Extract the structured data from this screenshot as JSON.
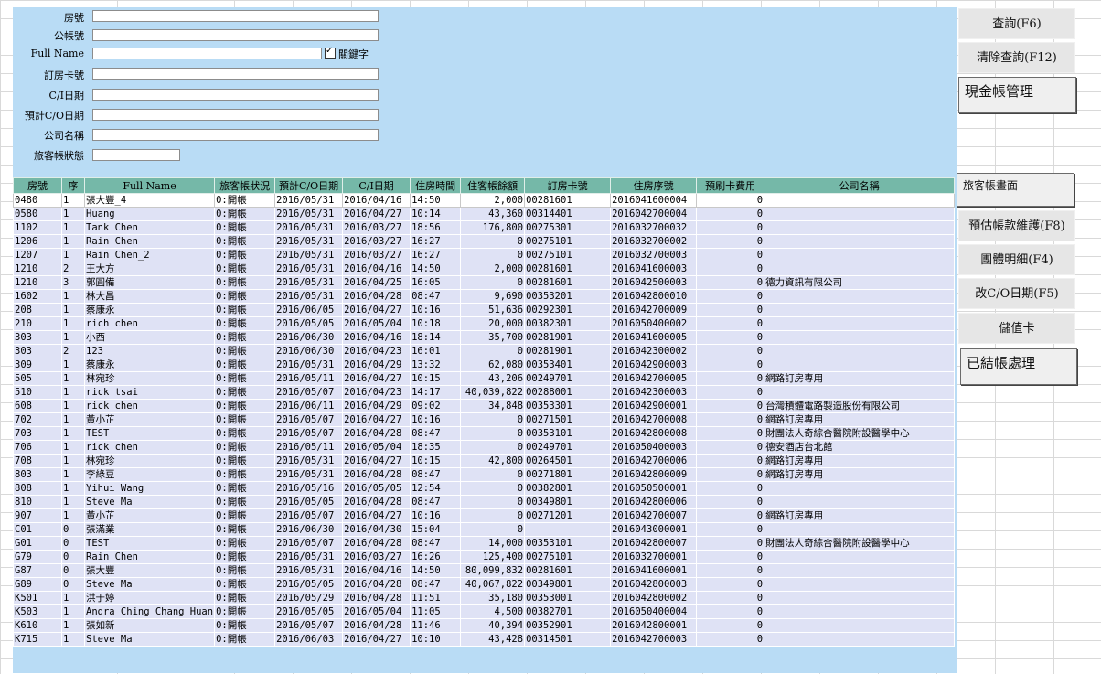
{
  "filters": {
    "room_label": "房號",
    "account_label": "公帳號",
    "name_label": "Full Name",
    "keyword_label": "關鍵字",
    "card_label": "訂房卡號",
    "ci_label": "C/I日期",
    "co_label": "預計C/O日期",
    "company_label": "公司名稱",
    "status_label": "旅客帳狀態"
  },
  "buttons": {
    "query": "查詢(F6)",
    "clear": "清除查詢(F12)",
    "cash": "現金帳管理",
    "guest_screen": "旅客帳畫面",
    "estimate": "預估帳款維護(F8)",
    "group_detail": "團體明細(F4)",
    "change_co": "改C/O日期(F5)",
    "stored_value": "儲值卡",
    "settled": "已結帳處理"
  },
  "table": {
    "headers": [
      "房號",
      "序",
      "Full Name",
      "旅客帳狀況",
      "預計C/O日期",
      "C/I日期",
      "住房時間",
      "住客帳餘額",
      "訂房卡號",
      "住房序號",
      "預刷卡費用",
      "公司名稱"
    ],
    "rows": [
      [
        "0480",
        "1",
        "張大豐_4",
        "0:開帳",
        "2016/05/31",
        "2016/04/16",
        "14:50",
        "2,000",
        "00281601",
        "2016041600004",
        "0",
        ""
      ],
      [
        "0580",
        "1",
        "Huang",
        "0:開帳",
        "2016/05/31",
        "2016/04/27",
        "10:14",
        "43,360",
        "00314401",
        "2016042700004",
        "0",
        ""
      ],
      [
        "1102",
        "1",
        "Tank Chen",
        "0:開帳",
        "2016/05/31",
        "2016/03/27",
        "18:56",
        "176,800",
        "00275301",
        "2016032700032",
        "0",
        ""
      ],
      [
        "1206",
        "1",
        "Rain Chen",
        "0:開帳",
        "2016/05/31",
        "2016/03/27",
        "16:27",
        "0",
        "00275101",
        "2016032700002",
        "0",
        ""
      ],
      [
        "1207",
        "1",
        "Rain Chen_2",
        "0:開帳",
        "2016/05/31",
        "2016/03/27",
        "16:27",
        "0",
        "00275101",
        "2016032700003",
        "0",
        ""
      ],
      [
        "1210",
        "2",
        "王大方",
        "0:開帳",
        "2016/05/31",
        "2016/04/16",
        "14:50",
        "2,000",
        "00281601",
        "2016041600003",
        "0",
        ""
      ],
      [
        "1210",
        "3",
        "郭圓備",
        "0:開帳",
        "2016/05/31",
        "2016/04/25",
        "16:05",
        "0",
        "00281601",
        "2016042500003",
        "0",
        "德力資訊有限公司"
      ],
      [
        "1602",
        "1",
        "林大昌",
        "0:開帳",
        "2016/05/31",
        "2016/04/28",
        "08:47",
        "9,690",
        "00353201",
        "2016042800010",
        "0",
        ""
      ],
      [
        "208",
        "1",
        "蔡康永",
        "0:開帳",
        "2016/06/05",
        "2016/04/27",
        "10:16",
        "51,636",
        "00292301",
        "2016042700009",
        "0",
        ""
      ],
      [
        "210",
        "1",
        "rich chen",
        "0:開帳",
        "2016/05/05",
        "2016/05/04",
        "10:18",
        "20,000",
        "00382301",
        "2016050400002",
        "0",
        ""
      ],
      [
        "303",
        "1",
        "小西",
        "0:開帳",
        "2016/06/30",
        "2016/04/16",
        "18:14",
        "35,700",
        "00281901",
        "2016041600005",
        "0",
        ""
      ],
      [
        "303",
        "2",
        "123",
        "0:開帳",
        "2016/06/30",
        "2016/04/23",
        "16:01",
        "0",
        "00281901",
        "2016042300002",
        "0",
        ""
      ],
      [
        "309",
        "1",
        "蔡康永",
        "0:開帳",
        "2016/05/31",
        "2016/04/29",
        "13:32",
        "62,080",
        "00353401",
        "2016042900003",
        "0",
        ""
      ],
      [
        "505",
        "1",
        "林宛珍",
        "0:開帳",
        "2016/05/11",
        "2016/04/27",
        "10:15",
        "43,206",
        "00249701",
        "2016042700005",
        "0",
        "網路訂房專用"
      ],
      [
        "510",
        "1",
        "rick tsai",
        "0:開帳",
        "2016/05/07",
        "2016/04/23",
        "14:17",
        "40,039,822",
        "00288001",
        "2016042300003",
        "0",
        ""
      ],
      [
        "608",
        "1",
        "rick chen",
        "0:開帳",
        "2016/06/11",
        "2016/04/29",
        "09:02",
        "34,848",
        "00353301",
        "2016042900001",
        "0",
        "台灣積體電路製造股份有限公司"
      ],
      [
        "702",
        "1",
        "黃小芷",
        "0:開帳",
        "2016/05/07",
        "2016/04/27",
        "10:16",
        "0",
        "00271501",
        "2016042700008",
        "0",
        "網路訂房專用"
      ],
      [
        "703",
        "1",
        "TEST",
        "0:開帳",
        "2016/05/07",
        "2016/04/28",
        "08:47",
        "0",
        "00353101",
        "2016042800008",
        "0",
        "財團法人奇綜合醫院附設醫學中心"
      ],
      [
        "706",
        "1",
        "rick chen",
        "0:開帳",
        "2016/05/11",
        "2016/05/04",
        "18:35",
        "0",
        "00249701",
        "2016050400003",
        "0",
        "德安酒店台北館"
      ],
      [
        "708",
        "1",
        "林宛珍",
        "0:開帳",
        "2016/05/31",
        "2016/04/27",
        "10:15",
        "42,800",
        "00264501",
        "2016042700006",
        "0",
        "網路訂房專用"
      ],
      [
        "803",
        "1",
        "李綠豆",
        "0:開帳",
        "2016/05/31",
        "2016/04/28",
        "08:47",
        "0",
        "00271801",
        "2016042800009",
        "0",
        "網路訂房專用"
      ],
      [
        "808",
        "1",
        "Yihui Wang",
        "0:開帳",
        "2016/05/16",
        "2016/05/05",
        "12:54",
        "0",
        "00382801",
        "2016050500001",
        "0",
        ""
      ],
      [
        "810",
        "1",
        "Steve Ma",
        "0:開帳",
        "2016/05/05",
        "2016/04/28",
        "08:47",
        "0",
        "00349801",
        "2016042800006",
        "0",
        ""
      ],
      [
        "907",
        "1",
        "黃小芷",
        "0:開帳",
        "2016/05/07",
        "2016/04/27",
        "10:16",
        "0",
        "00271201",
        "2016042700007",
        "0",
        "網路訂房專用"
      ],
      [
        "C01",
        "0",
        "張滿業",
        "0:開帳",
        "2016/06/30",
        "2016/04/30",
        "15:04",
        "0",
        "",
        "2016043000001",
        "0",
        ""
      ],
      [
        "G01",
        "0",
        "TEST",
        "0:開帳",
        "2016/05/07",
        "2016/04/28",
        "08:47",
        "14,000",
        "00353101",
        "2016042800007",
        "0",
        "財團法人奇綜合醫院附設醫學中心"
      ],
      [
        "G79",
        "0",
        "Rain Chen",
        "0:開帳",
        "2016/05/31",
        "2016/03/27",
        "16:26",
        "125,400",
        "00275101",
        "2016032700001",
        "0",
        ""
      ],
      [
        "G87",
        "0",
        "張大豐",
        "0:開帳",
        "2016/05/31",
        "2016/04/16",
        "14:50",
        "80,099,832",
        "00281601",
        "2016041600001",
        "0",
        ""
      ],
      [
        "G89",
        "0",
        "Steve Ma",
        "0:開帳",
        "2016/05/05",
        "2016/04/28",
        "08:47",
        "40,067,822",
        "00349801",
        "2016042800003",
        "0",
        ""
      ],
      [
        "K501",
        "1",
        "洪于婷",
        "0:開帳",
        "2016/05/29",
        "2016/04/28",
        "11:51",
        "35,180",
        "00353001",
        "2016042800002",
        "0",
        ""
      ],
      [
        "K503",
        "1",
        "Andra Ching Chang Huan",
        "0:開帳",
        "2016/05/05",
        "2016/05/04",
        "11:05",
        "4,500",
        "00382701",
        "2016050400004",
        "0",
        ""
      ],
      [
        "K610",
        "1",
        "張如新",
        "0:開帳",
        "2016/05/07",
        "2016/04/28",
        "11:46",
        "40,394",
        "00352901",
        "2016042800001",
        "0",
        ""
      ],
      [
        "K715",
        "1",
        "Steve Ma",
        "0:開帳",
        "2016/06/03",
        "2016/04/27",
        "10:10",
        "43,428",
        "00314501",
        "2016042700003",
        "0",
        ""
      ]
    ]
  }
}
